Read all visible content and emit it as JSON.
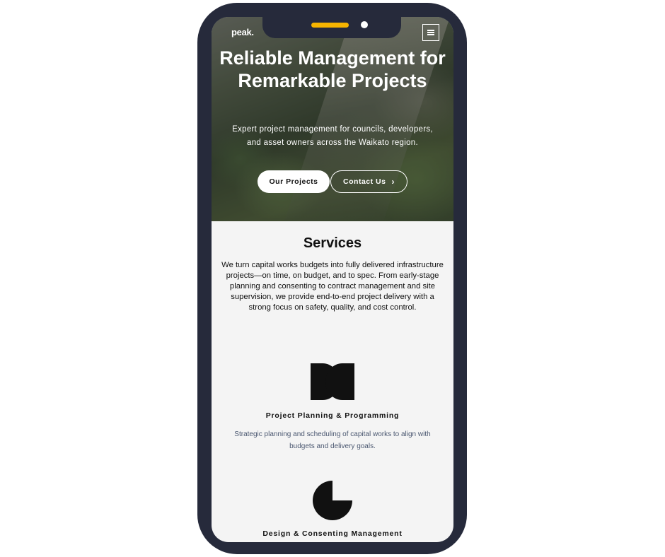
{
  "brand": {
    "logo_text": "peak."
  },
  "hero": {
    "title": "Reliable Management for Remarkable Projects",
    "subtitle": "Expert project management for councils, developers, and asset owners across the Waikato region.",
    "primary_button": "Our Projects",
    "secondary_button": "Contact Us"
  },
  "services": {
    "heading": "Services",
    "description": "We turn capital works budgets into fully delivered infrastructure projects—on time, on budget, and to spec. From early-stage planning and consenting to contract management and site supervision, we provide end-to-end project delivery with a strong focus on safety, quality, and cost control.",
    "items": [
      {
        "title": "Project Planning & Programming",
        "description": "Strategic planning and scheduling of capital works to align with budgets and delivery goals.",
        "icon": "planning-icon"
      },
      {
        "title": "Design & Consenting Management",
        "icon": "consenting-icon"
      }
    ]
  },
  "colors": {
    "phone_frame": "#262a3b",
    "notch_accent": "#f6b400",
    "screen_background": "#f4f4f4",
    "service_description_text": "#4a5770"
  }
}
